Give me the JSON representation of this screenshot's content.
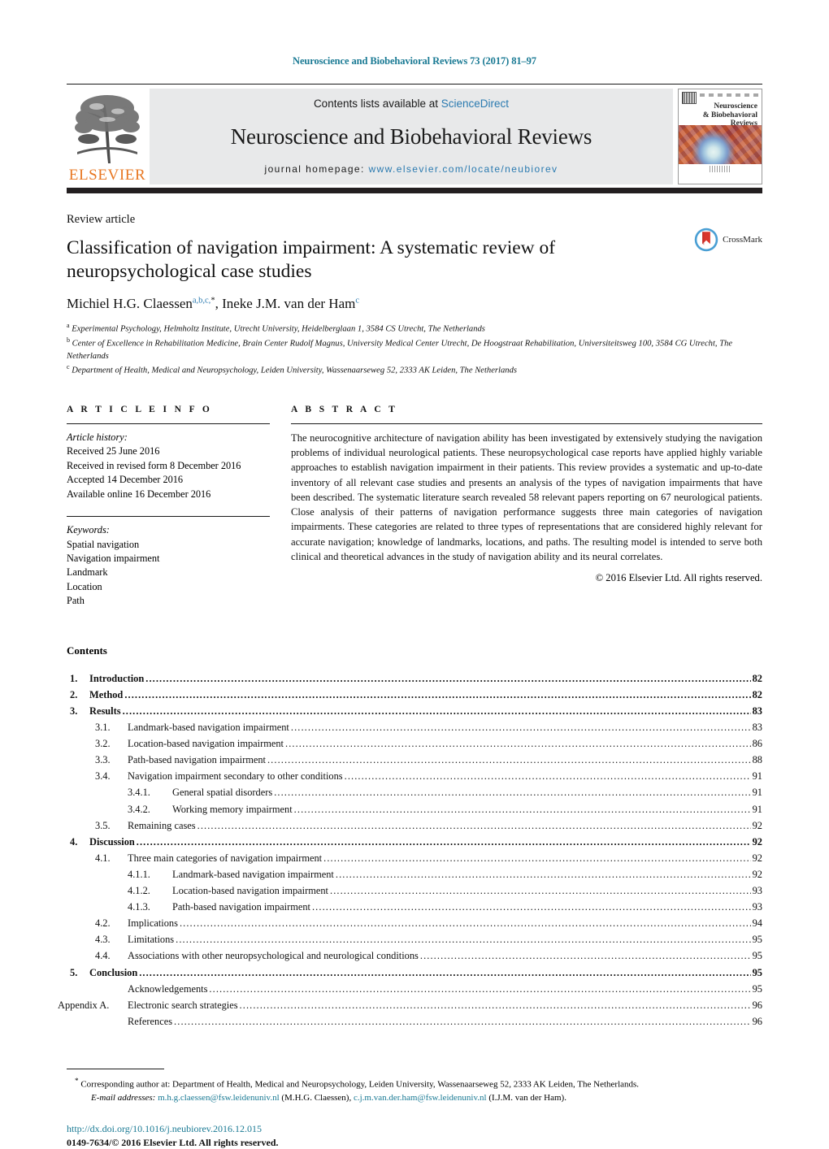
{
  "running_head": "Neuroscience and Biobehavioral Reviews 73 (2017) 81–97",
  "masthead": {
    "contents_prefix": "Contents lists available at ",
    "contents_link": "ScienceDirect",
    "journal_name": "Neuroscience and Biobehavioral Reviews",
    "homepage_prefix": "journal homepage: ",
    "homepage_url": "www.elsevier.com/locate/neubiorev",
    "publisher_wordmark": "ELSEVIER",
    "cover_title_line1": "Neuroscience",
    "cover_title_line2": "& Biobehavioral",
    "cover_title_line3": "Reviews"
  },
  "title_block": {
    "kicker": "Review article",
    "title": "Classification of navigation impairment: A systematic review of neuropsychological case studies",
    "author1_name": "Michiel H.G. Claessen",
    "author1_marks": "a,b,c,",
    "author1_star": "*",
    "author_sep": ", ",
    "author2_name": "Ineke J.M. van der Ham",
    "author2_marks": "c",
    "crossmark_label": "CrossMark",
    "affiliations": [
      {
        "mark": "a",
        "text": "Experimental Psychology, Helmholtz Institute, Utrecht University, Heidelberglaan 1, 3584 CS Utrecht, The Netherlands"
      },
      {
        "mark": "b",
        "text": "Center of Excellence in Rehabilitation Medicine, Brain Center Rudolf Magnus, University Medical Center Utrecht, De Hoogstraat Rehabilitation, Universiteitsweg 100, 3584 CG Utrecht, The Netherlands"
      },
      {
        "mark": "c",
        "text": "Department of Health, Medical and Neuropsychology, Leiden University, Wassenaarseweg 52, 2333 AK Leiden, The Netherlands"
      }
    ]
  },
  "article_info": {
    "heading": "A R T I C L E   I N F O",
    "history_label": "Article history:",
    "history": [
      "Received 25 June 2016",
      "Received in revised form 8 December 2016",
      "Accepted 14 December 2016",
      "Available online 16 December 2016"
    ],
    "keywords_label": "Keywords:",
    "keywords": [
      "Spatial navigation",
      "Navigation impairment",
      "Landmark",
      "Location",
      "Path"
    ]
  },
  "abstract": {
    "heading": "A B S T R A C T",
    "text": "The neurocognitive architecture of navigation ability has been investigated by extensively studying the navigation problems of individual neurological patients. These neuropsychological case reports have applied highly variable approaches to establish navigation impairment in their patients. This review provides a systematic and up-to-date inventory of all relevant case studies and presents an analysis of the types of navigation impairments that have been described. The systematic literature search revealed 58 relevant papers reporting on 67 neurological patients. Close analysis of their patterns of navigation performance suggests three main categories of navigation impairments. These categories are related to three types of representations that are considered highly relevant for accurate navigation; knowledge of landmarks, locations, and paths. The resulting model is intended to serve both clinical and theoretical advances in the study of navigation ability and its neural correlates.",
    "copyright": "© 2016 Elsevier Ltd. All rights reserved."
  },
  "contents": {
    "heading": "Contents",
    "entries": [
      {
        "level": 1,
        "num": "1.",
        "label": "Introduction",
        "page": "82"
      },
      {
        "level": 1,
        "num": "2.",
        "label": "Method",
        "page": "82"
      },
      {
        "level": 1,
        "num": "3.",
        "label": "Results",
        "page": "83"
      },
      {
        "level": 2,
        "num": "3.1.",
        "label": "Landmark-based navigation impairment",
        "page": "83"
      },
      {
        "level": 2,
        "num": "3.2.",
        "label": "Location-based navigation impairment",
        "page": "86"
      },
      {
        "level": 2,
        "num": "3.3.",
        "label": "Path-based navigation impairment",
        "page": "88"
      },
      {
        "level": 2,
        "num": "3.4.",
        "label": "Navigation impairment secondary to other conditions",
        "page": "91"
      },
      {
        "level": 3,
        "num": "3.4.1.",
        "label": "General spatial disorders",
        "page": "91"
      },
      {
        "level": 3,
        "num": "3.4.2.",
        "label": "Working memory impairment",
        "page": "91"
      },
      {
        "level": 2,
        "num": "3.5.",
        "label": "Remaining cases",
        "page": "92"
      },
      {
        "level": 1,
        "num": "4.",
        "label": "Discussion",
        "page": "92"
      },
      {
        "level": 2,
        "num": "4.1.",
        "label": "Three main categories of navigation impairment",
        "page": "92"
      },
      {
        "level": 3,
        "num": "4.1.1.",
        "label": "Landmark-based navigation impairment",
        "page": "92"
      },
      {
        "level": 3,
        "num": "4.1.2.",
        "label": "Location-based navigation impairment",
        "page": "93"
      },
      {
        "level": 3,
        "num": "4.1.3.",
        "label": "Path-based navigation impairment",
        "page": "93"
      },
      {
        "level": 2,
        "num": "4.2.",
        "label": "Implications",
        "page": "94"
      },
      {
        "level": 2,
        "num": "4.3.",
        "label": "Limitations",
        "page": "95"
      },
      {
        "level": 2,
        "num": "4.4.",
        "label": "Associations with other neuropsychological and neurological conditions",
        "page": "95"
      },
      {
        "level": 1,
        "num": "5.",
        "label": "Conclusion",
        "page": "95"
      },
      {
        "level": 0,
        "num": "",
        "label": "Acknowledgements",
        "page": "95"
      },
      {
        "level": 4,
        "num": "Appendix A.",
        "label": "Electronic search strategies",
        "page": "96"
      },
      {
        "level": 0,
        "num": "",
        "label": "References",
        "page": "96"
      }
    ]
  },
  "footer": {
    "star": "*",
    "corresponding": "Corresponding author at: Department of Health, Medical and Neuropsychology, Leiden University, Wassenaarseweg 52, 2333 AK Leiden, The Netherlands.",
    "email_label": "E-mail addresses:",
    "email1": "m.h.g.claessen@fsw.leidenuniv.nl",
    "email1_owner": "(M.H.G. Claessen),",
    "email2": "c.j.m.van.der.ham@fsw.leidenuniv.nl",
    "email2_owner": "(I.J.M. van der Ham).",
    "doi": "http://dx.doi.org/10.1016/j.neubiorev.2016.12.015",
    "issn_line": "0149-7634/© 2016 Elsevier Ltd. All rights reserved."
  },
  "colors": {
    "journal_teal": "#1a7a94",
    "link_blue": "#2a7ab0",
    "elsevier_orange": "#e87722",
    "bar_black": "#231f20",
    "masthead_grey": "#e8e9ea"
  }
}
